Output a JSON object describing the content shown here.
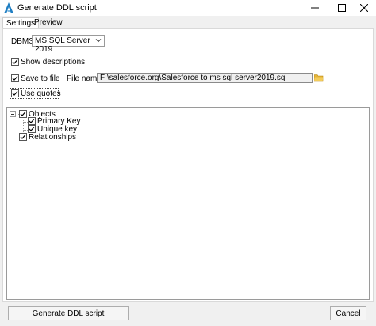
{
  "window": {
    "title": "Generate DDL script",
    "icons": {
      "app": "app-logo-icon",
      "minimize": "minimize-icon",
      "maximize": "maximize-icon",
      "close": "close-icon"
    }
  },
  "tabs": [
    {
      "label": "Settings",
      "active": true
    },
    {
      "label": "Preview",
      "active": false
    }
  ],
  "settings": {
    "dbms_label": "DBMS:",
    "dbms_value": "MS SQL Server 2019",
    "show_descriptions": {
      "label": "Show descriptions",
      "checked": true
    },
    "save_to_file": {
      "label": "Save to file",
      "checked": true
    },
    "file_name_label": "File name",
    "file_name_value": "F:\\salesforce.org\\Salesforce to ms sql server2019.sql",
    "use_quotes": {
      "label": "Use quotes",
      "checked": true
    }
  },
  "tree": {
    "objects": {
      "label": "Objects",
      "checked": true,
      "expanded": true
    },
    "primary_key": {
      "label": "Primary Key",
      "checked": true
    },
    "unique_key": {
      "label": "Unique key",
      "checked": true
    },
    "relationships": {
      "label": "Relationships",
      "checked": true
    }
  },
  "buttons": {
    "generate": "Generate DDL script",
    "cancel": "Cancel"
  },
  "colors": {
    "accent": "#1f7ec2",
    "folder": "#d9a520"
  }
}
